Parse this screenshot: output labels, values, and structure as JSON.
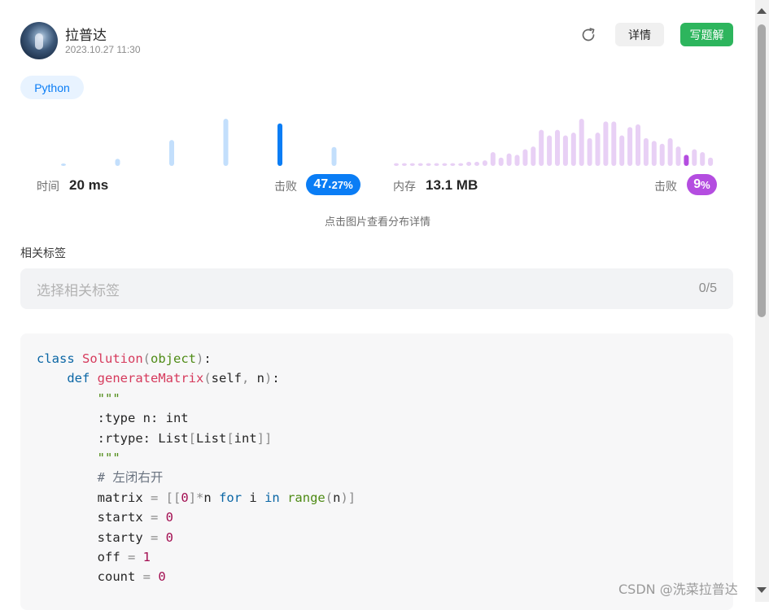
{
  "header": {
    "username": "拉普达",
    "post_time": "2023.10.27 11:30",
    "detail_label": "详情",
    "solution_label": "写题解"
  },
  "language_tag": "Python",
  "runtime": {
    "label": "时间",
    "value": "20 ms",
    "beat_label": "击败",
    "beat_main": "47.",
    "beat_frac": "27%",
    "color": "#0a7df5"
  },
  "memory": {
    "label": "内存",
    "value": "13.1 MB",
    "beat_label": "击败",
    "beat_main": "9",
    "beat_frac": "%",
    "color": "#b44de0"
  },
  "hint": "点击图片查看分布详情",
  "tags": {
    "label": "相关标签",
    "placeholder": "选择相关标签",
    "count": "0/5"
  },
  "code": {
    "language": "python",
    "lines": [
      "class Solution(object):",
      "    def generateMatrix(self, n):",
      "        \"\"\"",
      "        :type n: int",
      "        :rtype: List[List[int]]",
      "        \"\"\"",
      "        # 左闭右开",
      "        matrix = [[0]*n for i in range(n)]",
      "        startx = 0",
      "        starty = 0",
      "        off = 1",
      "        count = 0"
    ]
  },
  "watermark": "CSDN @洗菜拉普达",
  "chart_data": [
    {
      "type": "bar",
      "description_key": "runtime-distribution",
      "values": [
        1,
        3,
        11,
        20,
        18,
        8
      ],
      "highlight_index": 4,
      "colors": {
        "normal": "#c3dffc",
        "highlight": "#0a7df5"
      }
    },
    {
      "type": "bar",
      "description_key": "memory-distribution",
      "values": [
        1,
        1,
        1,
        1,
        1,
        1,
        1,
        1,
        1,
        1.5,
        1.5,
        2,
        5,
        3,
        4.5,
        4,
        6,
        7,
        13,
        11,
        13,
        11,
        12,
        17,
        10,
        12,
        16,
        16,
        11,
        14,
        15,
        10,
        9,
        8,
        10,
        7,
        4,
        6,
        5,
        3
      ],
      "highlight_index": 36,
      "colors": {
        "normal": "#e8d0f5",
        "highlight": "#b44de0"
      }
    }
  ]
}
